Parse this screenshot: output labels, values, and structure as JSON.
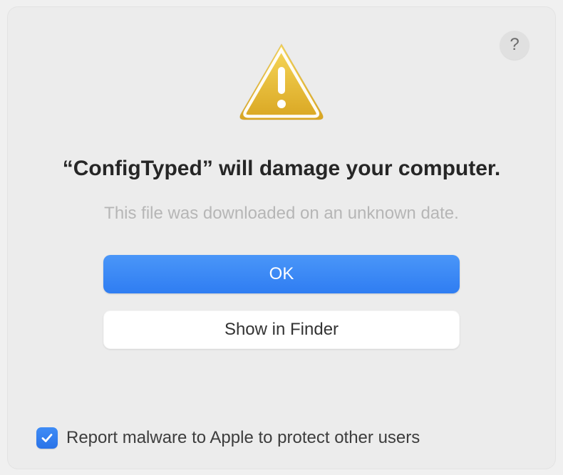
{
  "dialog": {
    "title": "“ConfigTyped” will damage your computer.",
    "subtitle": "This file was downloaded on an unknown date.",
    "help_label": "?",
    "buttons": {
      "primary": "OK",
      "secondary": "Show in Finder"
    },
    "checkbox": {
      "checked": true,
      "label": "Report malware to Apple to protect other users"
    },
    "icons": {
      "warning": "warning-triangle-icon",
      "help": "help-icon",
      "checkmark": "checkmark-icon"
    }
  }
}
